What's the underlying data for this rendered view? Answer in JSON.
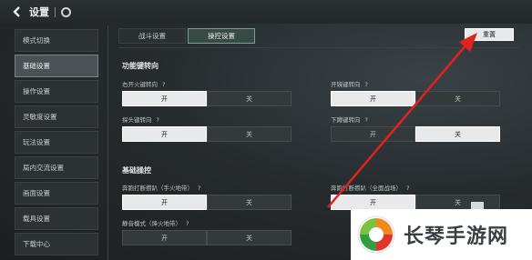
{
  "header": {
    "back_icon": "chevron-left-icon",
    "title": "设置",
    "extra_icon": "ring-icon"
  },
  "sidebar": {
    "items": [
      {
        "label": "模式切换",
        "active": false
      },
      {
        "label": "基础设置",
        "active": true
      },
      {
        "label": "操作设置",
        "active": false
      },
      {
        "label": "灵敏度设置",
        "active": false
      },
      {
        "label": "玩法设置",
        "active": false
      },
      {
        "label": "局内交流设置",
        "active": false
      },
      {
        "label": "画面设置",
        "active": false
      },
      {
        "label": "载具设置",
        "active": false
      },
      {
        "label": "下载中心",
        "active": false
      }
    ]
  },
  "tabs": [
    {
      "label": "战斗设置",
      "active": false
    },
    {
      "label": "操控设置",
      "active": true
    }
  ],
  "reset_button": "重置",
  "sections": {
    "function_keys": {
      "title": "功能键转向",
      "settings": [
        {
          "label": "右开火键转向",
          "on": "开",
          "off": "关",
          "selected": "on"
        },
        {
          "label": "开镜键转向",
          "on": "开",
          "off": "关",
          "selected": "on"
        },
        {
          "label": "探头键转向",
          "on": "开",
          "off": "关",
          "selected": "on"
        },
        {
          "label": "下蹲键转向",
          "on": "开",
          "off": "关",
          "selected": "off"
        }
      ]
    },
    "basic_controls": {
      "title": "基础操控",
      "settings": [
        {
          "label": "奔跑打断攒趴（手火地带）",
          "on": "开",
          "off": "关",
          "selected": "on"
        },
        {
          "label": "奔跑打断攒趴（全面战场）",
          "on": "开",
          "off": "关",
          "selected": "on"
        },
        {
          "label": "静音模式（烽火地带）",
          "on": "开",
          "off": "关",
          "selected": null
        }
      ]
    }
  },
  "watermark": {
    "text": "长琴手游网"
  },
  "colors": {
    "annotation_arrow": "#e0231c",
    "selected": "#e7e9ea",
    "active_tab": "#394a44"
  }
}
